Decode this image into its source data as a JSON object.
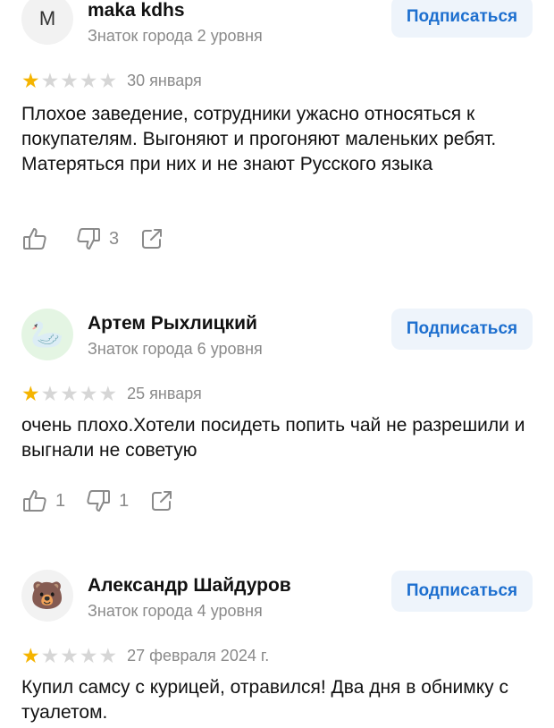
{
  "reviews": [
    {
      "avatar_letter": "M",
      "avatar_icon": "",
      "name": "maka kdhs",
      "level": "Знаток города 2 уровня",
      "subscribe_label": "Подписаться",
      "rating": 1,
      "rating_max": 5,
      "date": "30 января",
      "text": "Плохое заведение, сотрудники ужасно относяться к покупателям. Выгоняют и прогоняют маленьких ребят. Матеряться при них и не знают Русского языка",
      "likes": "",
      "dislikes": "3"
    },
    {
      "avatar_letter": "",
      "avatar_icon": "goose-icon",
      "avatar_glyph": "🦢",
      "name": "Артем Рыхлицкий",
      "level": "Знаток города 6 уровня",
      "subscribe_label": "Подписаться",
      "rating": 1,
      "rating_max": 5,
      "date": "25 января",
      "text": "очень плохо.Хотели посидеть попить чай не разрешили и выгнали не советую",
      "likes": "1",
      "dislikes": "1"
    },
    {
      "avatar_letter": "",
      "avatar_icon": "bear-icon",
      "avatar_glyph": "🐻",
      "name": "Александр Шайдуров",
      "level": "Знаток города 4 уровня",
      "subscribe_label": "Подписаться",
      "rating": 1,
      "rating_max": 5,
      "date": "27 февраля 2024 г.",
      "text": "Купил самсу с курицей, отравился! Два дня в обнимку с туалетом.",
      "likes": "",
      "dislikes": ""
    }
  ],
  "colors": {
    "star_on": "#f5b400",
    "star_off": "#d6d6d6",
    "accent": "#1d6fcf",
    "button_bg": "#eef4fb",
    "muted": "#8a8a8a"
  }
}
